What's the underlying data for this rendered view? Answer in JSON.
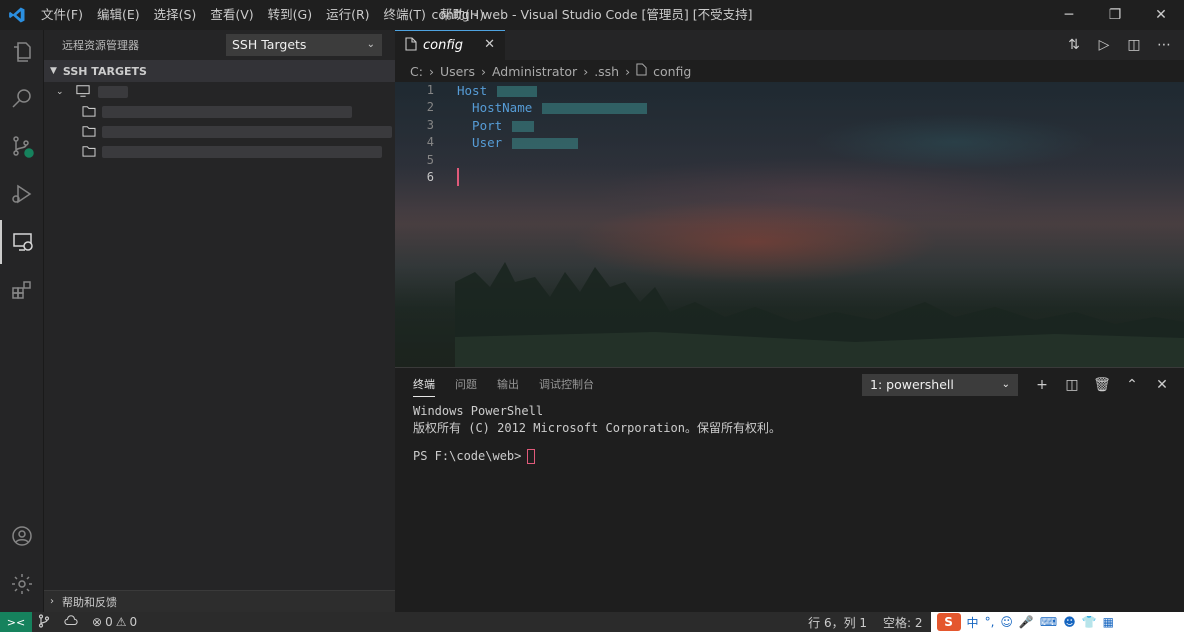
{
  "window": {
    "title": "config - web - Visual Studio Code [管理员] [不受支持]",
    "minimize": "─",
    "restore": "❐",
    "close": "✕"
  },
  "menu": [
    "文件(F)",
    "编辑(E)",
    "选择(S)",
    "查看(V)",
    "转到(G)",
    "运行(R)",
    "终端(T)",
    "帮助(H)"
  ],
  "sidebar": {
    "title": "远程资源管理器",
    "target_select": "SSH Targets",
    "section": "SSH TARGETS",
    "help_section": "帮助和反馈"
  },
  "editor": {
    "tab": "config",
    "breadcrumbs": [
      "C:",
      "Users",
      "Administrator",
      ".ssh",
      "config"
    ],
    "lines": [
      {
        "num": "1",
        "text": "Host"
      },
      {
        "num": "2",
        "text": "  HostName"
      },
      {
        "num": "3",
        "text": "  Port"
      },
      {
        "num": "4",
        "text": "  User"
      },
      {
        "num": "5",
        "text": ""
      },
      {
        "num": "6",
        "text": ""
      }
    ]
  },
  "panel": {
    "tabs": [
      "终端",
      "问题",
      "输出",
      "调试控制台"
    ],
    "terminal_select": "1: powershell",
    "lines": [
      "Windows PowerShell",
      "版权所有 (C) 2012 Microsoft Corporation。保留所有权利。",
      "",
      "PS F:\\code\\web>"
    ]
  },
  "statusbar": {
    "remote": "><",
    "errors": "0",
    "warnings": "0",
    "position": "行 6，列 1",
    "spaces": "空格: 2",
    "ime_lang": "中"
  },
  "colors": {
    "accent": "#007acc",
    "remote": "#16825d",
    "keyword": "#569cd6"
  }
}
